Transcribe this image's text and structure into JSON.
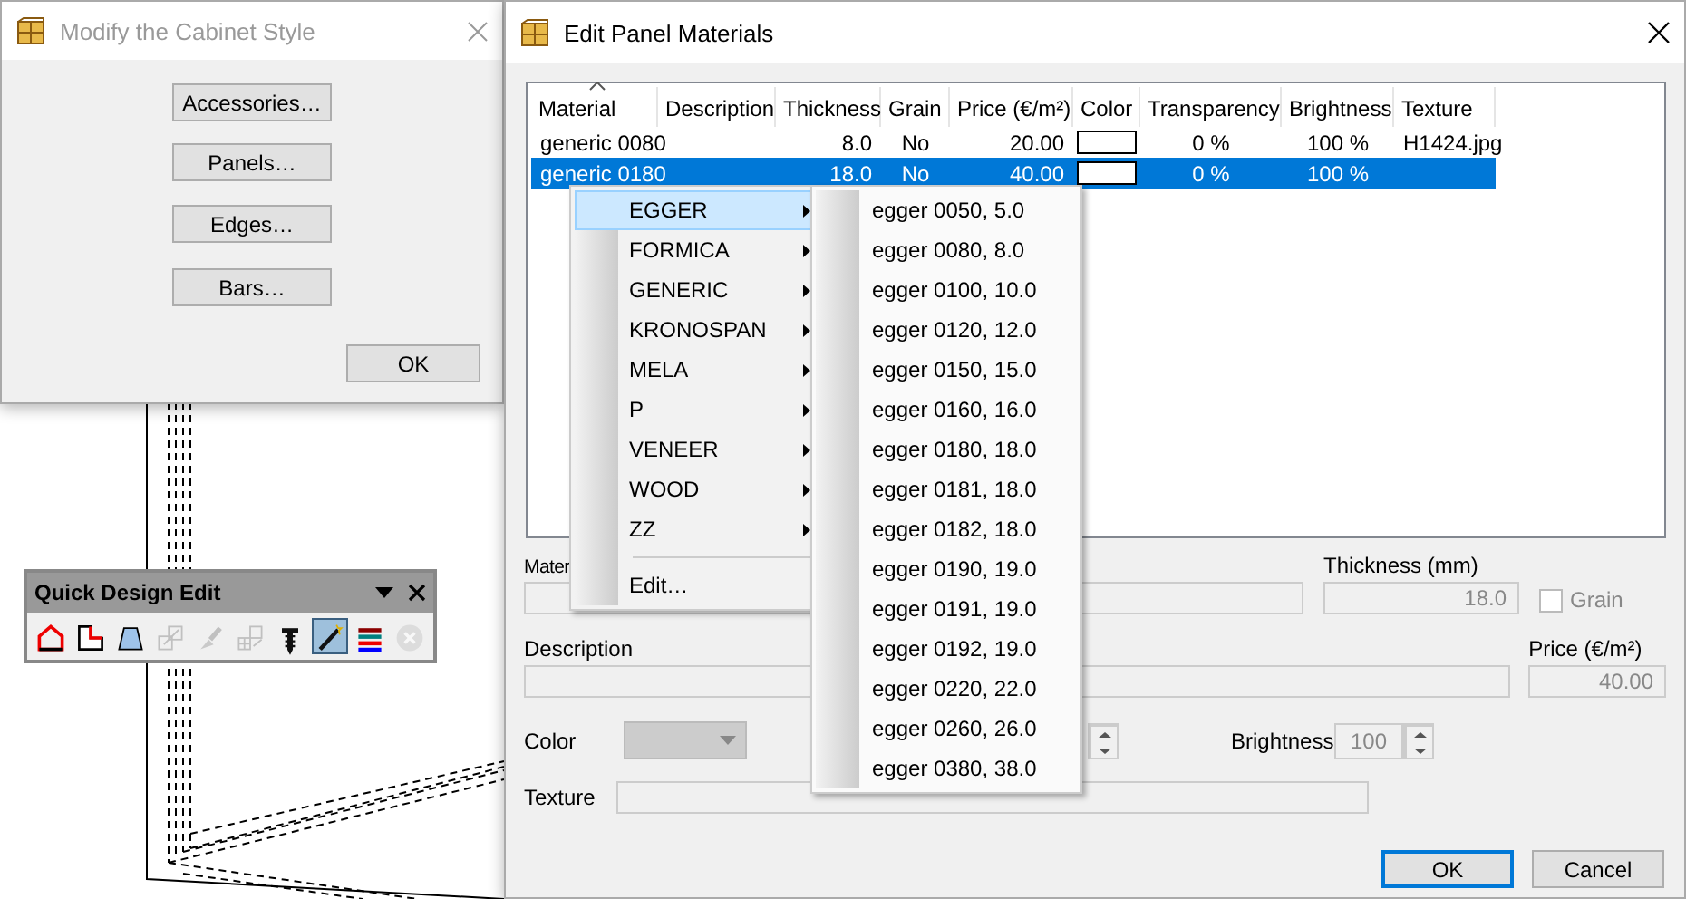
{
  "style_window": {
    "title": "Modify the Cabinet Style",
    "buttons": [
      "Accessories…",
      "Panels…",
      "Edges…",
      "Bars…"
    ],
    "ok": "OK"
  },
  "toolbar": {
    "title": "Quick Design Edit",
    "tools": [
      {
        "kind": "roof",
        "selected": false,
        "disabled": false
      },
      {
        "kind": "notch",
        "selected": false,
        "disabled": false
      },
      {
        "kind": "trapezoid",
        "selected": false,
        "disabled": false
      },
      {
        "kind": "resize",
        "selected": false,
        "disabled": true
      },
      {
        "kind": "brush",
        "selected": false,
        "disabled": true
      },
      {
        "kind": "arrange",
        "selected": false,
        "disabled": true
      },
      {
        "kind": "screw",
        "selected": false,
        "disabled": false
      },
      {
        "kind": "wand",
        "selected": true,
        "disabled": false
      },
      {
        "kind": "lines",
        "selected": false,
        "disabled": false
      },
      {
        "kind": "cancel",
        "selected": false,
        "disabled": true
      }
    ]
  },
  "materials_window": {
    "title": "Edit Panel Materials",
    "table": {
      "columns": [
        "Material",
        "Description",
        "Thickness",
        "Grain",
        "Price (€/m²)",
        "Color",
        "Transparency",
        "Brightness",
        "Texture"
      ],
      "rows": [
        {
          "material": "generic 0080",
          "thickness": "8.0",
          "grain": "No",
          "price": "20.00",
          "color": "#ffffff",
          "transparency": "0 %",
          "brightness": "100 %",
          "texture": "H1424.jpg",
          "selected": false
        },
        {
          "material": "generic 0180",
          "thickness": "18.0",
          "grain": "No",
          "price": "40.00",
          "color": "#ffffff",
          "transparency": "0 %",
          "brightness": "100 %",
          "selected": true
        }
      ]
    },
    "form": {
      "material_label": "Mater",
      "thickness_label": "Thickness (mm)",
      "thickness_value": "18.0",
      "grain_label": "Grain",
      "grain_checked": false,
      "description_label": "Description",
      "price_label": "Price (€/m²)",
      "price_value": "40.00",
      "color_label": "Color",
      "brightness_label": "Brightness",
      "brightness_value": "100",
      "texture_label": "Texture"
    },
    "buttons": [
      "OK",
      "Cancel"
    ]
  },
  "context_menu": {
    "items": [
      {
        "label": "EGGER",
        "has_submenu": true,
        "selected": true
      },
      {
        "label": "FORMICA",
        "has_submenu": true,
        "selected": false
      },
      {
        "label": "GENERIC",
        "has_submenu": true,
        "selected": false
      },
      {
        "label": "KRONOSPAN",
        "has_submenu": true,
        "selected": false
      },
      {
        "label": "MELA",
        "has_submenu": true,
        "selected": false
      },
      {
        "label": "P",
        "has_submenu": true,
        "selected": false
      },
      {
        "label": "VENEER",
        "has_submenu": true,
        "selected": false
      },
      {
        "label": "WOOD",
        "has_submenu": true,
        "selected": false
      },
      {
        "label": "ZZ",
        "has_submenu": true,
        "selected": false
      },
      {
        "label": "Edit…",
        "has_submenu": false,
        "selected": false
      }
    ],
    "submenu": [
      "egger 0050, 5.0",
      "egger 0080, 8.0",
      "egger 0100, 10.0",
      "egger 0120, 12.0",
      "egger 0150, 15.0",
      "egger 0160, 16.0",
      "egger 0180, 18.0",
      "egger 0181, 18.0",
      "egger 0182, 18.0",
      "egger 0190, 19.0",
      "egger 0191, 19.0",
      "egger 0192, 19.0",
      "egger 0220, 22.0",
      "egger 0260, 26.0",
      "egger 0380, 38.0"
    ]
  }
}
